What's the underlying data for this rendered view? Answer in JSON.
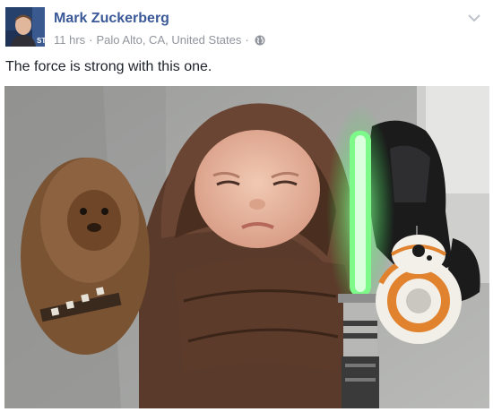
{
  "post": {
    "author_name": "Mark Zuckerberg",
    "timestamp": "11 hrs",
    "separator_1": "·",
    "location": "Palo Alto, CA, United States",
    "separator_2": "·",
    "privacy_icon": "globe-icon",
    "menu_icon": "chevron-down-icon",
    "status_text": "The force is strong with this one.",
    "avatar_badge_text": "STU"
  },
  "colors": {
    "author_link": "#3b5998",
    "meta_text": "#90949c",
    "body_text": "#1d2129"
  }
}
